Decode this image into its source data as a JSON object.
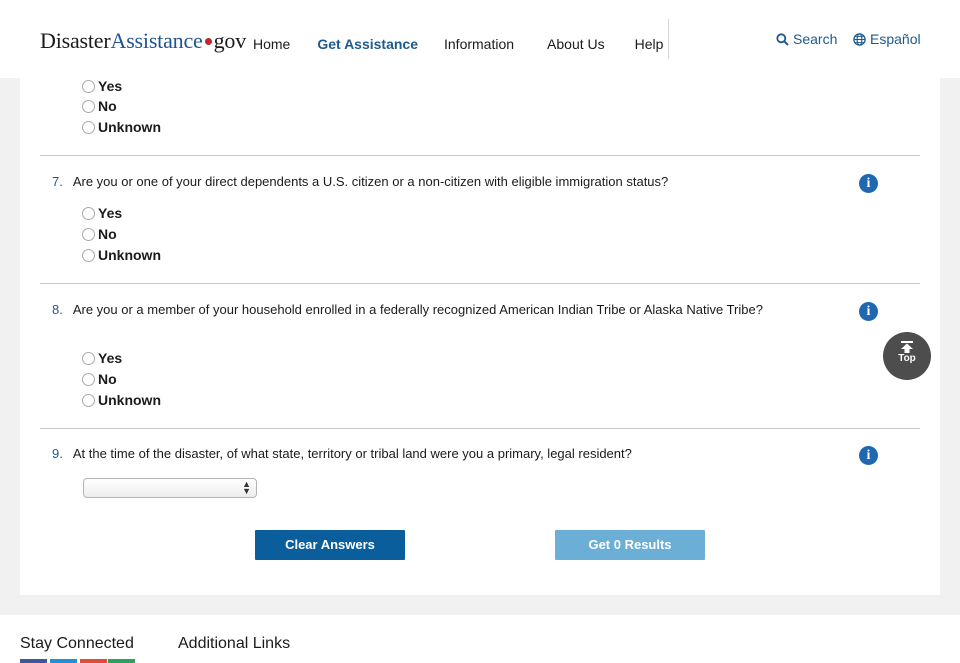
{
  "header": {
    "logo": {
      "part1": "Disaster",
      "part2": "Assistance",
      "part3": "gov"
    },
    "nav": [
      "Home",
      "Get Assistance",
      "Information",
      "About Us",
      "Help"
    ],
    "active_nav": "Get Assistance",
    "search_label": "Search",
    "language_label": "Español"
  },
  "questions": [
    {
      "number": "",
      "text": "",
      "options": [
        "Yes",
        "No",
        "Unknown"
      ]
    },
    {
      "number": "7.",
      "text": "Are you or one of your direct dependents a U.S. citizen or a non-citizen with eligible immigration status?",
      "options": [
        "Yes",
        "No",
        "Unknown"
      ]
    },
    {
      "number": "8.",
      "text": "Are you or a member of your household enrolled in a federally recognized American Indian Tribe or Alaska Native Tribe?",
      "options": [
        "Yes",
        "No",
        "Unknown"
      ]
    },
    {
      "number": "9.",
      "text": "At the time of the disaster, of what state, territory or tribal land were you a primary, legal resident?",
      "select_value": ""
    }
  ],
  "buttons": {
    "clear": "Clear Answers",
    "results": "Get 0 Results"
  },
  "top_button": "Top",
  "footer": {
    "stay_connected": "Stay Connected",
    "additional_links": "Additional Links"
  },
  "colors": {
    "brand_blue": "#1d5a8e",
    "logo_red": "#c0262d",
    "clear_button": "#0b5e9c",
    "results_button": "#6baed6",
    "info_icon": "#1f67b0"
  },
  "icons": [
    "search-icon",
    "globe-icon",
    "info-icon",
    "arrow-up-icon",
    "facebook-icon",
    "twitter-icon",
    "google-plus-icon",
    "share-icon"
  ]
}
